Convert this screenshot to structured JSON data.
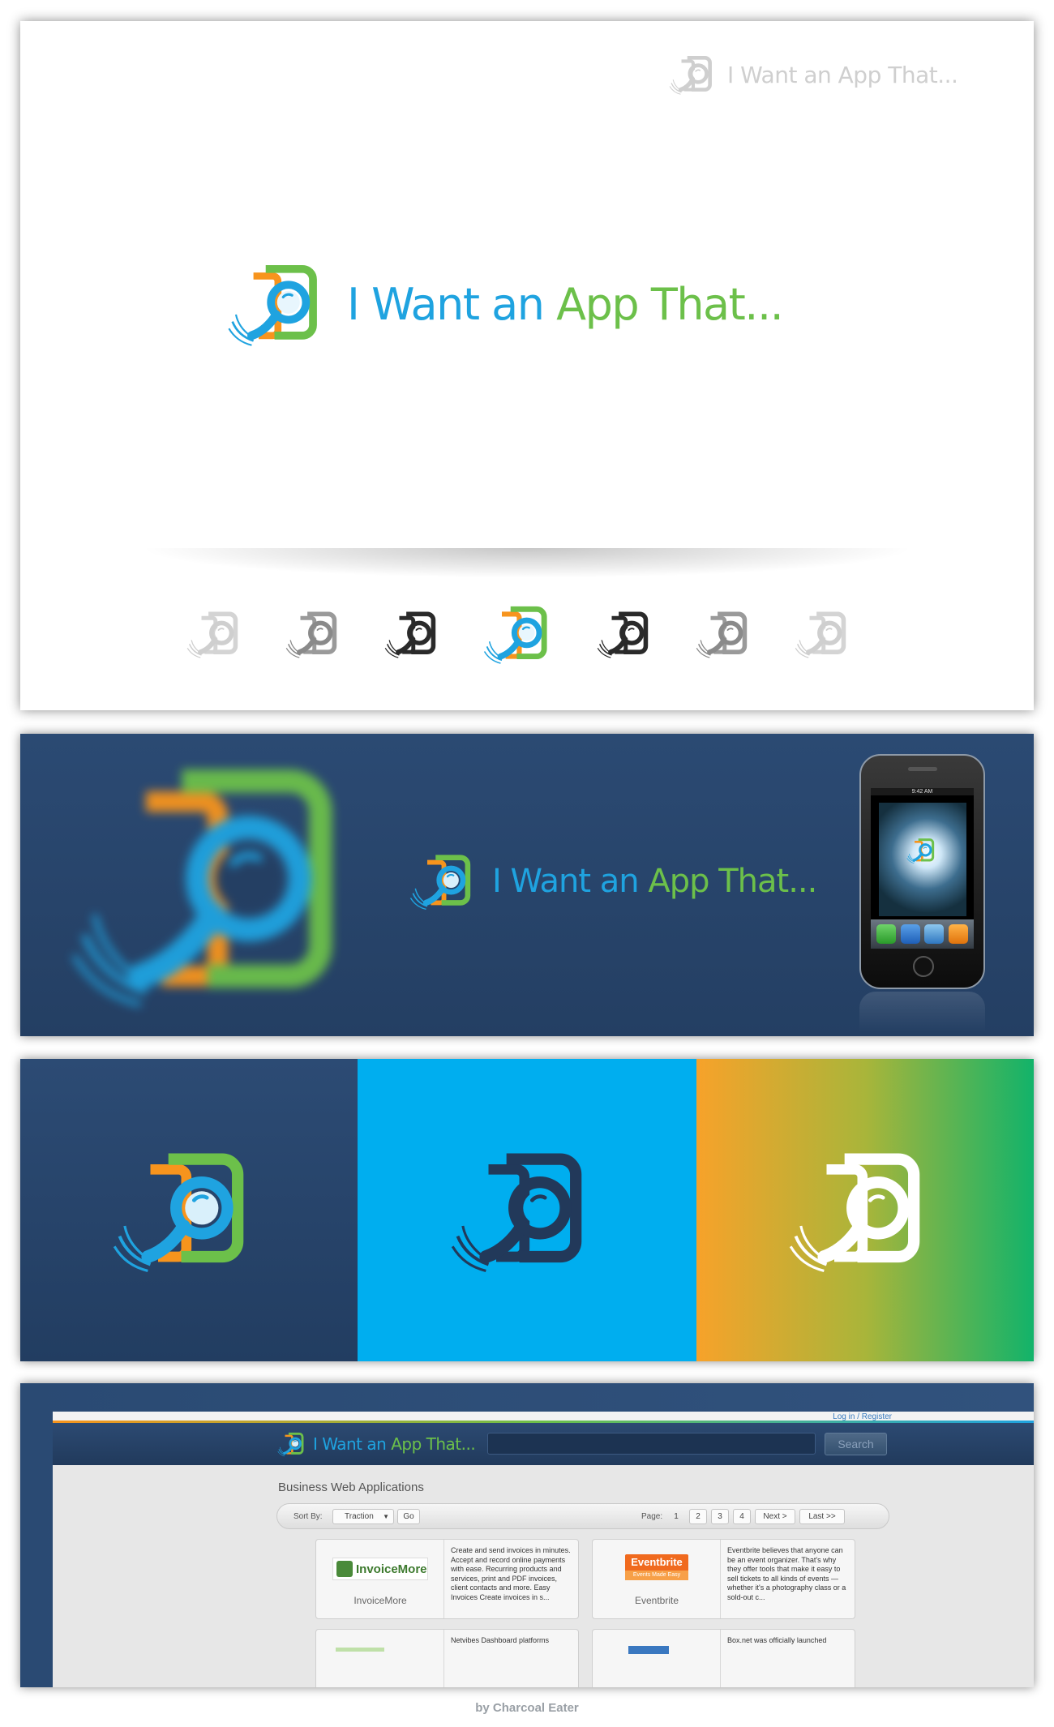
{
  "brand": {
    "name_part1": "I Want an",
    "name_part2": "App That...",
    "full_name": "I Want an App That...",
    "colors": {
      "blue": "#1fa3e0",
      "green": "#6cc04a",
      "orange": "#f7941d",
      "navy": "#2b4a73",
      "cyan": "#00aeef"
    }
  },
  "icon_variants": [
    "light-gray",
    "mid-gray",
    "dark",
    "full-color",
    "dark",
    "mid-gray",
    "light-gray"
  ],
  "swatches": [
    {
      "background": "#2b4a73",
      "icon_style": "full-color"
    },
    {
      "background": "#00aeef",
      "icon_style": "navy"
    },
    {
      "background": "orange-to-green gradient",
      "icon_style": "white"
    }
  ],
  "phone": {
    "status_time": "9:42 AM",
    "dock_icons": [
      "phone-icon",
      "mail-icon",
      "safari-icon",
      "ipod-icon"
    ]
  },
  "website": {
    "login_link": "Log in / Register",
    "search_button": "Search",
    "heading": "Business Web Applications",
    "toolbar": {
      "sort_label": "Sort By:",
      "sort_value": "Traction",
      "go_label": "Go",
      "page_label": "Page:",
      "pages": [
        "1",
        "2",
        "3",
        "4"
      ],
      "next_label": "Next >",
      "last_label": "Last >>"
    },
    "cards": [
      {
        "name": "InvoiceMore",
        "logo_text": "InvoiceMore",
        "logo_tagline": "",
        "description": "Create and send invoices in minutes. Accept and record online payments with ease. Recurring products and services, print and PDF invoices, client contacts and more. Easy Invoices Create invoices in s..."
      },
      {
        "name": "Eventbrite",
        "logo_text": "Eventbrite",
        "logo_tagline": "Events Made Easy",
        "description": "Eventbrite believes that anyone can be an event organizer. That's why they offer tools that make it easy to sell tickets to all kinds of events — whether it's a photography class or a sold-out c..."
      },
      {
        "name": "",
        "logo_text": "",
        "logo_tagline": "",
        "description": "Netvibes Dashboard platforms"
      },
      {
        "name": "",
        "logo_text": "",
        "logo_tagline": "",
        "description": "Box.net was officially launched"
      }
    ]
  },
  "credit": "by Charcoal Eater"
}
